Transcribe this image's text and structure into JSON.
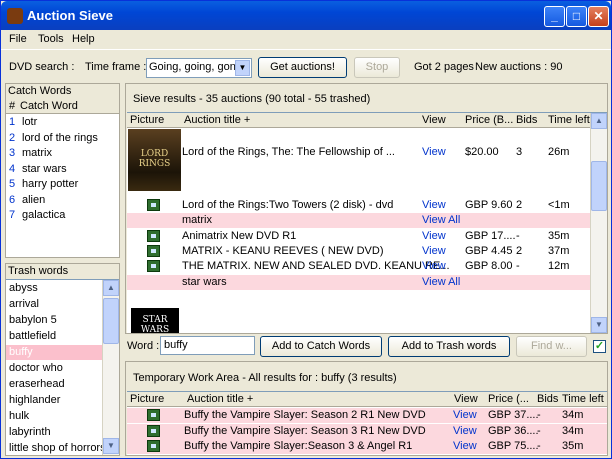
{
  "window": {
    "title": "Auction Sieve"
  },
  "menu": [
    "File",
    "Tools",
    "Help"
  ],
  "toolbar": {
    "dvd_search_label": "DVD search :",
    "time_frame_label": "Time frame :",
    "time_frame_value": "Going, going, gone",
    "get_auctions": "Get auctions!",
    "stop": "Stop",
    "status": "Got 2 pages",
    "new_auctions": "New auctions : 90"
  },
  "catch_words": {
    "title": "Catch Words",
    "col_num": "#",
    "col_word": "Catch Word",
    "items": [
      {
        "n": "1",
        "w": "lotr"
      },
      {
        "n": "2",
        "w": "lord of the rings"
      },
      {
        "n": "3",
        "w": "matrix"
      },
      {
        "n": "4",
        "w": "star wars"
      },
      {
        "n": "5",
        "w": "harry potter"
      },
      {
        "n": "6",
        "w": "alien"
      },
      {
        "n": "7",
        "w": "galactica"
      }
    ]
  },
  "trash_words": {
    "title": "Trash words",
    "items": [
      "abyss",
      "arrival",
      "babylon 5",
      "battlefield",
      "buffy",
      "doctor who",
      "eraserhead",
      "highlander",
      "hulk",
      "labyrinth",
      "little shop of horrors"
    ]
  },
  "sieve": {
    "header": "Sieve results - 35 auctions (90 total - 55 trashed)",
    "columns": [
      "Picture",
      "Auction title +",
      "View",
      "Price (B...",
      "Bids",
      "Time left"
    ],
    "rows": [
      {
        "title": "Lord of the Rings, The: The Fellowship of ...",
        "view": "View",
        "price": "$20.00",
        "bids": "3",
        "time": "26m"
      },
      {
        "title": "Lord of the Rings:Two Towers (2 disk) - dvd",
        "view": "View",
        "price": "GBP 9.60",
        "bids": "2",
        "time": "<1m"
      },
      {
        "title": "matrix",
        "view": "View All",
        "price": "",
        "bids": "",
        "time": ""
      },
      {
        "title": "Animatrix New DVD R1",
        "view": "View",
        "price": "GBP 17....",
        "bids": "-",
        "time": "35m"
      },
      {
        "title": "MATRIX - KEANU REEVES ( NEW DVD)",
        "view": "View",
        "price": "GBP 4.45",
        "bids": "2",
        "time": "37m"
      },
      {
        "title": "THE MATRIX. NEW AND SEALED DVD. KEANU RE...",
        "view": "View",
        "price": "GBP 8.00",
        "bids": "-",
        "time": "12m"
      },
      {
        "title": "star wars",
        "view": "View All",
        "price": "",
        "bids": "",
        "time": ""
      }
    ],
    "poster1": "LORD RINGS",
    "poster2": "STAR WARS"
  },
  "word_bar": {
    "label": "Word :",
    "value": "buffy",
    "add_catch": "Add to Catch Words",
    "add_trash": "Add to Trash words",
    "find": "Find w..."
  },
  "temp": {
    "header": "Temporary Work Area -   All results for :   buffy (3 results)",
    "columns": [
      "Picture",
      "Auction title +",
      "View",
      "Price (...",
      "Bids",
      "Time left"
    ],
    "rows": [
      {
        "title": "Buffy the Vampire Slayer: Season 2 R1 New DVD",
        "view": "View",
        "price": "GBP 37....",
        "bids": "-",
        "time": "34m"
      },
      {
        "title": "Buffy the Vampire Slayer: Season 3 R1 New DVD",
        "view": "View",
        "price": "GBP 36....",
        "bids": "-",
        "time": "34m"
      },
      {
        "title": "Buffy the Vampire Slayer:Season 3 & Angel R1",
        "view": "View",
        "price": "GBP 75....",
        "bids": "-",
        "time": "35m"
      }
    ]
  }
}
